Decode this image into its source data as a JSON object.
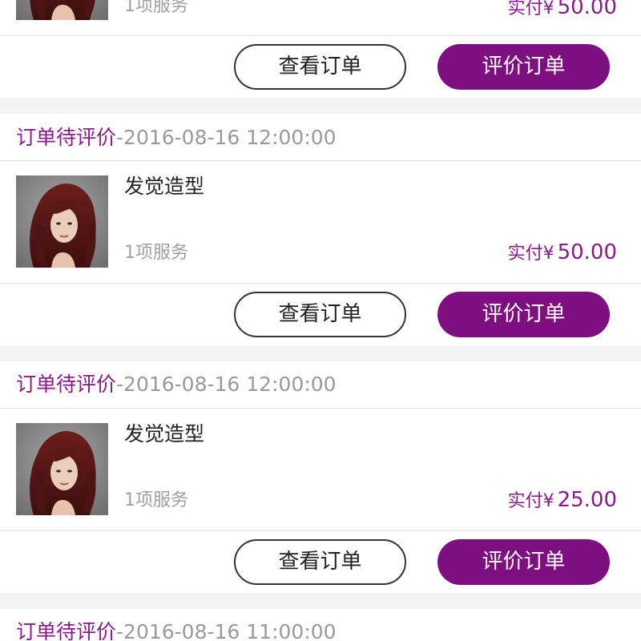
{
  "colors": {
    "accent": "#7d0f7f",
    "status_text": "#8a1a8a",
    "muted": "#9a9a9a",
    "background": "#f4f4f4"
  },
  "orders": [
    {
      "status": "",
      "time": "",
      "item_title": "",
      "item_count": "1项服务",
      "paid_label": "实付¥",
      "paid_amount": "50.00",
      "view_label": "查看订单",
      "review_label": "评价订单",
      "thumbnail_icon": "hairstyle-photo"
    },
    {
      "status": "订单待评价",
      "time": "-2016-08-16 12:00:00",
      "item_title": "发觉造型",
      "item_count": "1项服务",
      "paid_label": "实付¥",
      "paid_amount": "50.00",
      "view_label": "查看订单",
      "review_label": "评价订单",
      "thumbnail_icon": "hairstyle-photo"
    },
    {
      "status": "订单待评价",
      "time": "-2016-08-16 12:00:00",
      "item_title": "发觉造型",
      "item_count": "1项服务",
      "paid_label": "实付¥",
      "paid_amount": "25.00",
      "view_label": "查看订单",
      "review_label": "评价订单",
      "thumbnail_icon": "hairstyle-photo"
    },
    {
      "status": "订单待评价",
      "time": "-2016-08-16 11:00:00"
    }
  ]
}
